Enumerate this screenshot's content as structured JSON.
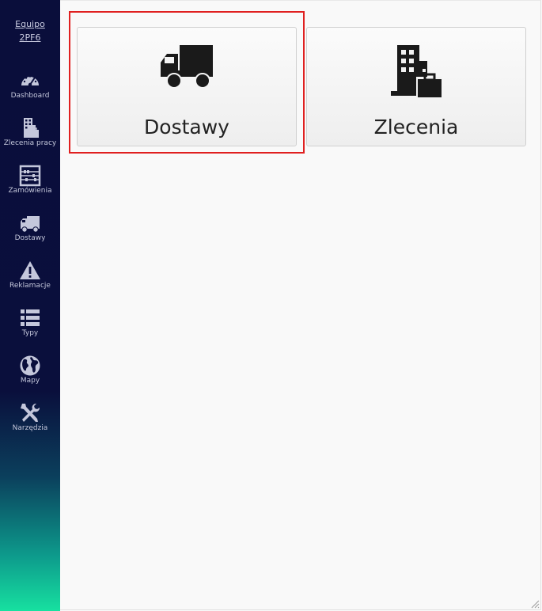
{
  "sidebar": {
    "company_line1": "Equipo",
    "company_line2": "2PF6",
    "items": [
      {
        "label": "Dashboard",
        "icon": "dashboard-gauge-icon"
      },
      {
        "label": "Zlecenia pracy",
        "icon": "building-icon"
      },
      {
        "label": "Zamówienia",
        "icon": "abacus-icon"
      },
      {
        "label": "Dostawy",
        "icon": "truck-icon"
      },
      {
        "label": "Reklamacje",
        "icon": "warning-icon"
      },
      {
        "label": "Typy",
        "icon": "list-icon"
      },
      {
        "label": "Mapy",
        "icon": "globe-icon"
      },
      {
        "label": "Narzędzia",
        "icon": "tools-icon"
      }
    ]
  },
  "tiles": [
    {
      "label": "Dostawy",
      "icon": "truck-icon"
    },
    {
      "label": "Zlecenia",
      "icon": "building-icon"
    }
  ],
  "colors": {
    "sidebar_top": "#0a0e3b",
    "sidebar_bottom": "#17e0a0",
    "highlight": "#e02020",
    "icon": "#1a1a1a"
  }
}
